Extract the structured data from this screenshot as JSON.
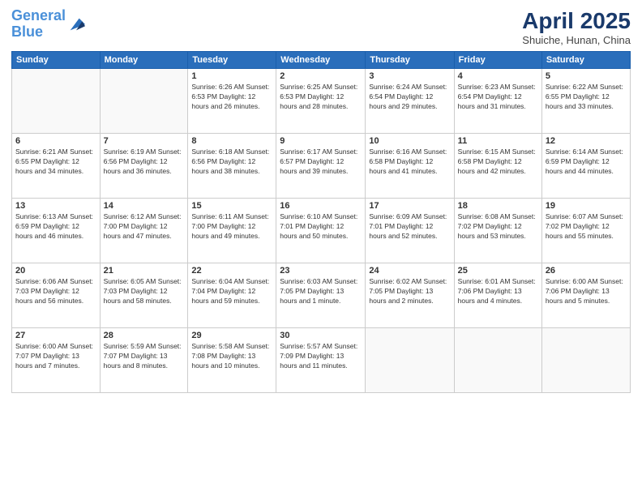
{
  "header": {
    "logo_line1": "General",
    "logo_line2": "Blue",
    "month": "April 2025",
    "location": "Shuiche, Hunan, China"
  },
  "weekdays": [
    "Sunday",
    "Monday",
    "Tuesday",
    "Wednesday",
    "Thursday",
    "Friday",
    "Saturday"
  ],
  "weeks": [
    [
      {
        "day": "",
        "info": ""
      },
      {
        "day": "",
        "info": ""
      },
      {
        "day": "1",
        "info": "Sunrise: 6:26 AM\nSunset: 6:53 PM\nDaylight: 12 hours\nand 26 minutes."
      },
      {
        "day": "2",
        "info": "Sunrise: 6:25 AM\nSunset: 6:53 PM\nDaylight: 12 hours\nand 28 minutes."
      },
      {
        "day": "3",
        "info": "Sunrise: 6:24 AM\nSunset: 6:54 PM\nDaylight: 12 hours\nand 29 minutes."
      },
      {
        "day": "4",
        "info": "Sunrise: 6:23 AM\nSunset: 6:54 PM\nDaylight: 12 hours\nand 31 minutes."
      },
      {
        "day": "5",
        "info": "Sunrise: 6:22 AM\nSunset: 6:55 PM\nDaylight: 12 hours\nand 33 minutes."
      }
    ],
    [
      {
        "day": "6",
        "info": "Sunrise: 6:21 AM\nSunset: 6:55 PM\nDaylight: 12 hours\nand 34 minutes."
      },
      {
        "day": "7",
        "info": "Sunrise: 6:19 AM\nSunset: 6:56 PM\nDaylight: 12 hours\nand 36 minutes."
      },
      {
        "day": "8",
        "info": "Sunrise: 6:18 AM\nSunset: 6:56 PM\nDaylight: 12 hours\nand 38 minutes."
      },
      {
        "day": "9",
        "info": "Sunrise: 6:17 AM\nSunset: 6:57 PM\nDaylight: 12 hours\nand 39 minutes."
      },
      {
        "day": "10",
        "info": "Sunrise: 6:16 AM\nSunset: 6:58 PM\nDaylight: 12 hours\nand 41 minutes."
      },
      {
        "day": "11",
        "info": "Sunrise: 6:15 AM\nSunset: 6:58 PM\nDaylight: 12 hours\nand 42 minutes."
      },
      {
        "day": "12",
        "info": "Sunrise: 6:14 AM\nSunset: 6:59 PM\nDaylight: 12 hours\nand 44 minutes."
      }
    ],
    [
      {
        "day": "13",
        "info": "Sunrise: 6:13 AM\nSunset: 6:59 PM\nDaylight: 12 hours\nand 46 minutes."
      },
      {
        "day": "14",
        "info": "Sunrise: 6:12 AM\nSunset: 7:00 PM\nDaylight: 12 hours\nand 47 minutes."
      },
      {
        "day": "15",
        "info": "Sunrise: 6:11 AM\nSunset: 7:00 PM\nDaylight: 12 hours\nand 49 minutes."
      },
      {
        "day": "16",
        "info": "Sunrise: 6:10 AM\nSunset: 7:01 PM\nDaylight: 12 hours\nand 50 minutes."
      },
      {
        "day": "17",
        "info": "Sunrise: 6:09 AM\nSunset: 7:01 PM\nDaylight: 12 hours\nand 52 minutes."
      },
      {
        "day": "18",
        "info": "Sunrise: 6:08 AM\nSunset: 7:02 PM\nDaylight: 12 hours\nand 53 minutes."
      },
      {
        "day": "19",
        "info": "Sunrise: 6:07 AM\nSunset: 7:02 PM\nDaylight: 12 hours\nand 55 minutes."
      }
    ],
    [
      {
        "day": "20",
        "info": "Sunrise: 6:06 AM\nSunset: 7:03 PM\nDaylight: 12 hours\nand 56 minutes."
      },
      {
        "day": "21",
        "info": "Sunrise: 6:05 AM\nSunset: 7:03 PM\nDaylight: 12 hours\nand 58 minutes."
      },
      {
        "day": "22",
        "info": "Sunrise: 6:04 AM\nSunset: 7:04 PM\nDaylight: 12 hours\nand 59 minutes."
      },
      {
        "day": "23",
        "info": "Sunrise: 6:03 AM\nSunset: 7:05 PM\nDaylight: 13 hours\nand 1 minute."
      },
      {
        "day": "24",
        "info": "Sunrise: 6:02 AM\nSunset: 7:05 PM\nDaylight: 13 hours\nand 2 minutes."
      },
      {
        "day": "25",
        "info": "Sunrise: 6:01 AM\nSunset: 7:06 PM\nDaylight: 13 hours\nand 4 minutes."
      },
      {
        "day": "26",
        "info": "Sunrise: 6:00 AM\nSunset: 7:06 PM\nDaylight: 13 hours\nand 5 minutes."
      }
    ],
    [
      {
        "day": "27",
        "info": "Sunrise: 6:00 AM\nSunset: 7:07 PM\nDaylight: 13 hours\nand 7 minutes."
      },
      {
        "day": "28",
        "info": "Sunrise: 5:59 AM\nSunset: 7:07 PM\nDaylight: 13 hours\nand 8 minutes."
      },
      {
        "day": "29",
        "info": "Sunrise: 5:58 AM\nSunset: 7:08 PM\nDaylight: 13 hours\nand 10 minutes."
      },
      {
        "day": "30",
        "info": "Sunrise: 5:57 AM\nSunset: 7:09 PM\nDaylight: 13 hours\nand 11 minutes."
      },
      {
        "day": "",
        "info": ""
      },
      {
        "day": "",
        "info": ""
      },
      {
        "day": "",
        "info": ""
      }
    ]
  ]
}
